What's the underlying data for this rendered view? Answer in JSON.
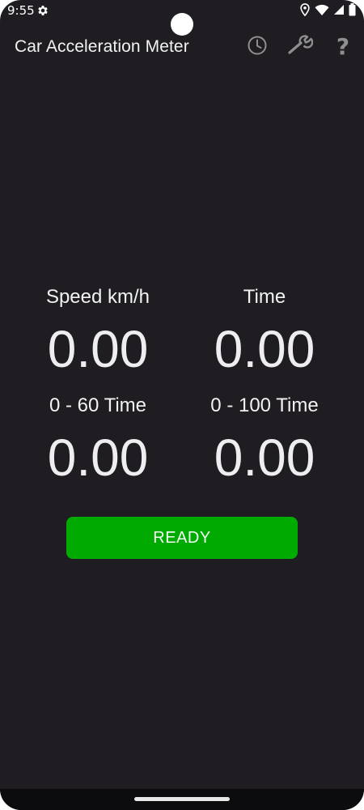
{
  "status_bar": {
    "time": "9:55",
    "icons": [
      "gear-icon",
      "location-icon",
      "wifi-icon",
      "signal-icon",
      "battery-icon"
    ]
  },
  "app_bar": {
    "title": "Car Acceleration Meter",
    "actions": [
      {
        "name": "history",
        "icon": "clock-icon"
      },
      {
        "name": "settings",
        "icon": "wrench-icon"
      },
      {
        "name": "help",
        "icon": "question-icon",
        "glyph": "?"
      }
    ]
  },
  "readings": {
    "speed": {
      "label": "Speed km/h",
      "value": "0.00"
    },
    "time": {
      "label": "Time",
      "value": "0.00"
    },
    "zero_to_60": {
      "label": "0 - 60 Time",
      "value": "0.00"
    },
    "zero_to_100": {
      "label": "0 - 100 Time",
      "value": "0.00"
    }
  },
  "ready_button": {
    "label": "READY"
  },
  "colors": {
    "background": "#1f1d21",
    "accent_green": "#00aa00",
    "text": "#f2f2f2",
    "icon_gray": "#8f8f8f"
  }
}
